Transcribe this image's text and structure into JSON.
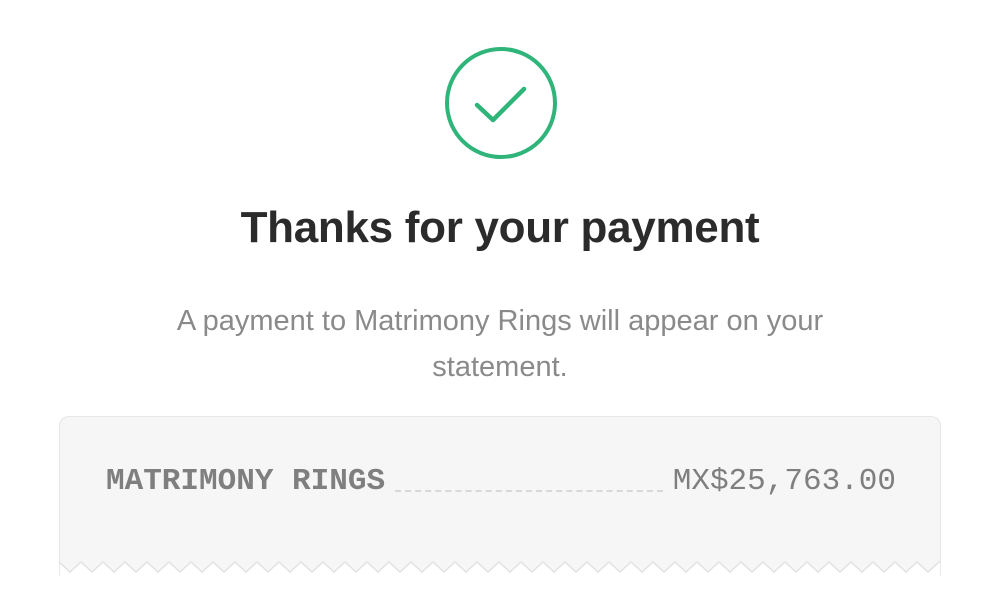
{
  "confirmation": {
    "icon": "checkmark-circle-icon",
    "accent_color": "#2fb47a",
    "title": "Thanks for your payment",
    "message": "A payment to Matrimony Rings will appear on your statement."
  },
  "receipt": {
    "merchant": "MATRIMONY RINGS",
    "amount": "MX$25,763.00"
  }
}
